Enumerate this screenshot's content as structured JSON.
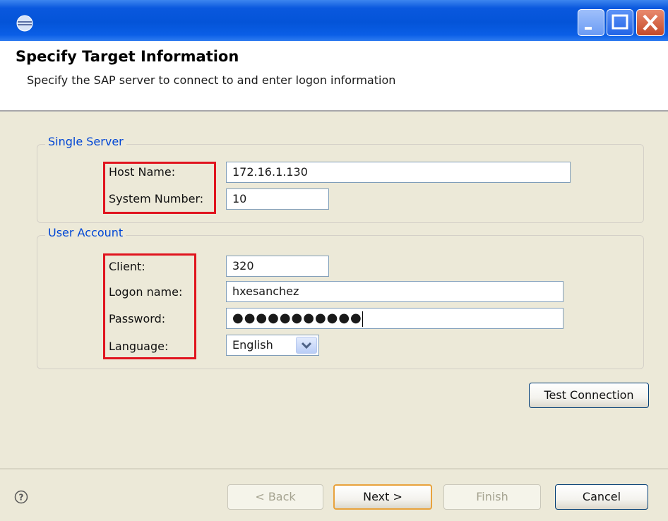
{
  "window": {
    "title": "",
    "controls": {
      "minimize": "minimize",
      "maximize": "maximize",
      "close": "close"
    }
  },
  "header": {
    "title": "Specify Target Information",
    "subtitle": "Specify the SAP server to connect to and enter logon information"
  },
  "single_server": {
    "legend": "Single Server",
    "host_label": "Host Name:",
    "host_value": "172.16.1.130",
    "sysnum_label": "System Number:",
    "sysnum_value": "10"
  },
  "user_account": {
    "legend": "User Account",
    "client_label": "Client:",
    "client_value": "320",
    "logon_label": "Logon name:",
    "logon_value": "hxesanchez",
    "password_label": "Password:",
    "password_value": "●●●●●●●●●●●",
    "language_label": "Language:",
    "language_value": "English"
  },
  "actions": {
    "test_connection": "Test Connection"
  },
  "footer": {
    "help_icon": "?",
    "back": "< Back",
    "next": "Next >",
    "finish": "Finish",
    "cancel": "Cancel"
  },
  "colors": {
    "titlebar": "#0a58de",
    "body": "#ece9d8",
    "group_legend": "#0046d5",
    "highlight": "#e0141e"
  }
}
